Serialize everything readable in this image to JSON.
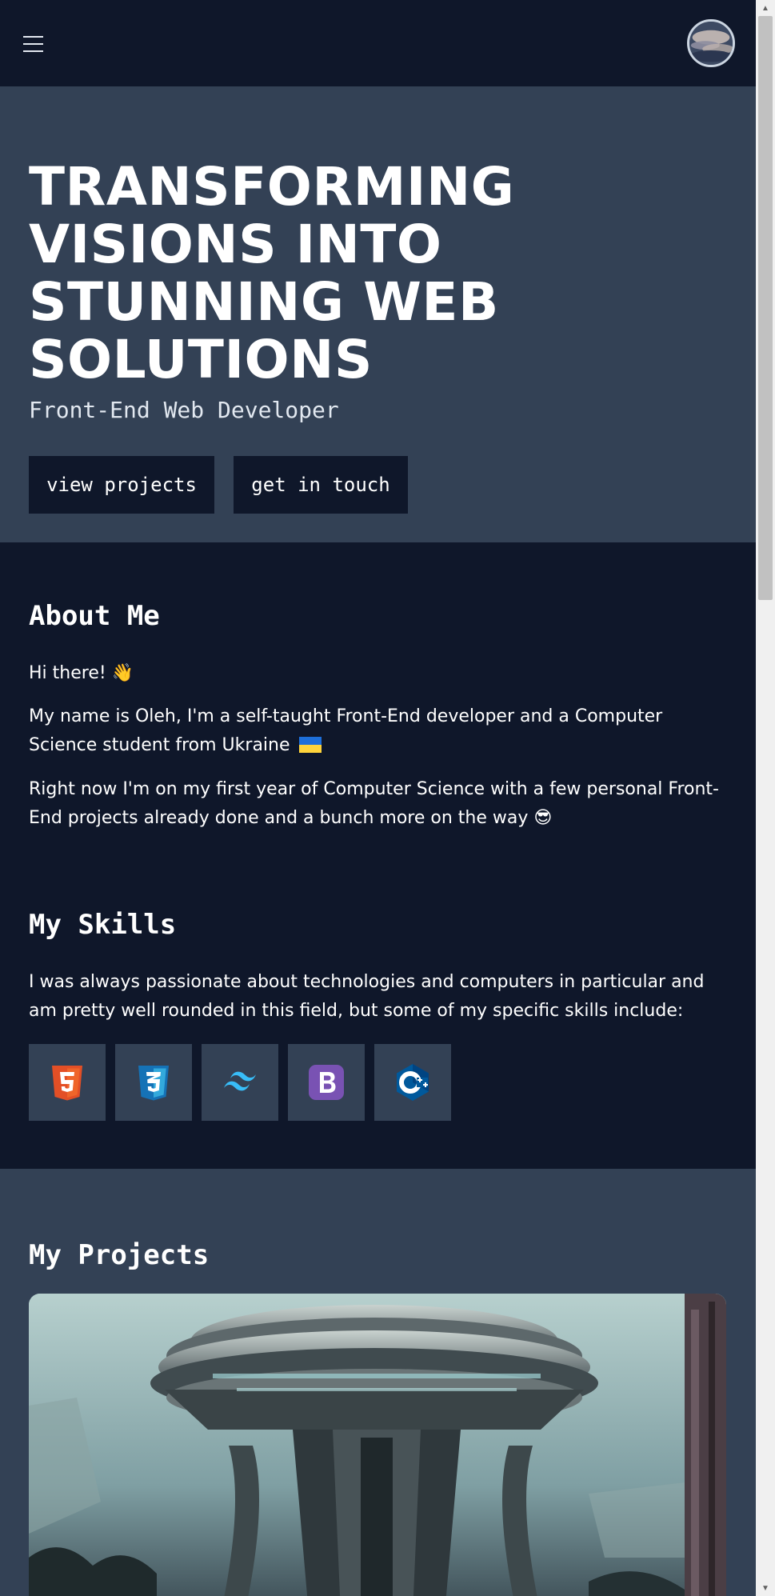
{
  "header": {
    "menu_icon": "hamburger-menu-icon",
    "avatar_icon": "profile-avatar"
  },
  "hero": {
    "title": "TRANSFORMING VISIONS INTO STUNNING WEB SOLUTIONS",
    "subtitle": "Front-End Web Developer",
    "primary_button": "view projects",
    "secondary_button": "get in touch"
  },
  "about": {
    "title": "About Me",
    "greeting": "Hi there!",
    "greeting_emoji": "👋",
    "intro": "My name is Oleh, I'm a self-taught Front-End developer and a Computer Science student from Ukraine",
    "status": "Right now I'm on my first year of Computer Science with a few personal Front-End projects already done and a bunch more on the way",
    "status_emoji": "😎"
  },
  "skills": {
    "title": "My Skills",
    "description": "I was always passionate about technologies and computers in particular and am pretty well rounded in this field, but some of my specific skills include:",
    "items": [
      {
        "icon": "html5-icon",
        "color": "#e34f26"
      },
      {
        "icon": "css3-icon",
        "color": "#1572b6"
      },
      {
        "icon": "tailwind-icon",
        "color": "#38bdf8"
      },
      {
        "icon": "bootstrap-icon",
        "color": "#7952b3"
      },
      {
        "icon": "cplusplus-icon",
        "color": "#00599c"
      }
    ]
  },
  "projects": {
    "title": "My Projects"
  },
  "colors": {
    "dark_bg": "#0f172a",
    "slate_bg": "#334155",
    "text": "#ffffff"
  }
}
